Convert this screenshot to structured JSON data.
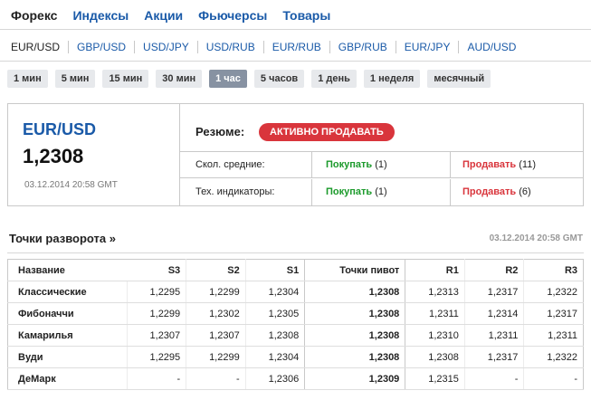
{
  "nav": {
    "tabs": [
      "Форекс",
      "Индексы",
      "Акции",
      "Фьючерсы",
      "Товары"
    ],
    "active_tab": "Форекс"
  },
  "pairs": {
    "items": [
      "EUR/USD",
      "GBP/USD",
      "USD/JPY",
      "USD/RUB",
      "EUR/RUB",
      "GBP/RUB",
      "EUR/JPY",
      "AUD/USD"
    ],
    "active": "EUR/USD"
  },
  "timeframes": {
    "items": [
      "1 мин",
      "5 мин",
      "15 мин",
      "30 мин",
      "1 час",
      "5 часов",
      "1 день",
      "1 неделя",
      "месячный"
    ],
    "active": "1 час"
  },
  "summary": {
    "pair": "EUR/USD",
    "price": "1,2308",
    "timestamp": "03.12.2014 20:58 GMT",
    "resume_label": "Резюме:",
    "resume_value": "АКТИВНО ПРОДАВАТЬ",
    "indicators": [
      {
        "label": "Скол. средние:",
        "buy_label": "Покупать",
        "buy_count": "(1)",
        "sell_label": "Продавать",
        "sell_count": "(11)"
      },
      {
        "label": "Тех. индикаторы:",
        "buy_label": "Покупать",
        "buy_count": "(1)",
        "sell_label": "Продавать",
        "sell_count": "(6)"
      }
    ]
  },
  "pivot": {
    "title": "Точки разворота »",
    "timestamp": "03.12.2014 20:58 GMT",
    "headers": [
      "Название",
      "S3",
      "S2",
      "S1",
      "Точки пивот",
      "R1",
      "R2",
      "R3"
    ],
    "rows": [
      [
        "Классические",
        "1,2295",
        "1,2299",
        "1,2304",
        "1,2308",
        "1,2313",
        "1,2317",
        "1,2322"
      ],
      [
        "Фибоначчи",
        "1,2299",
        "1,2302",
        "1,2305",
        "1,2308",
        "1,2311",
        "1,2314",
        "1,2317"
      ],
      [
        "Камарилья",
        "1,2307",
        "1,2307",
        "1,2308",
        "1,2308",
        "1,2310",
        "1,2311",
        "1,2311"
      ],
      [
        "Вуди",
        "1,2295",
        "1,2299",
        "1,2304",
        "1,2308",
        "1,2308",
        "1,2317",
        "1,2322"
      ],
      [
        "ДеМарк",
        "-",
        "-",
        "1,2306",
        "1,2309",
        "1,2315",
        "-",
        "-"
      ]
    ]
  },
  "colors": {
    "link": "#1a5aa8",
    "buy": "#1b9a2b",
    "sell": "#d9353c",
    "active_timeframe": "#8792a2"
  }
}
